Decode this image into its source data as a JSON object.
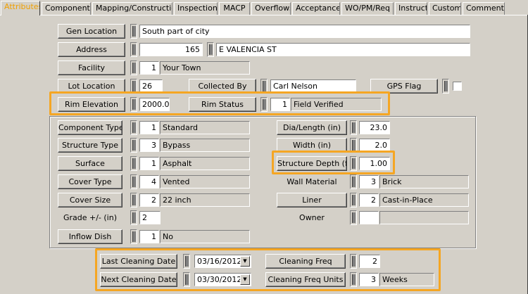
{
  "tabs": [
    "Attributes",
    "Components",
    "Mapping/Construction",
    "Inspections",
    "MACP",
    "Overflows",
    "Acceptance",
    "WO/PM/Req",
    "Instruct",
    "Custom",
    "Comments"
  ],
  "top": {
    "gen_location": {
      "label": "Gen Location",
      "value": "South part of city"
    },
    "address": {
      "label": "Address",
      "number": "165",
      "street": "E VALENCIA ST"
    },
    "facility": {
      "label": "Facility",
      "code": "1",
      "value": "Your Town"
    },
    "lot_location": {
      "label": "Lot Location",
      "value": "26"
    },
    "collected_by": {
      "label": "Collected By",
      "value": "Carl Nelson"
    },
    "gps_flag": {
      "label": "GPS Flag"
    },
    "rim_elevation": {
      "label": "Rim Elevation",
      "value": "2000.00"
    },
    "rim_status": {
      "label": "Rim Status",
      "code": "1",
      "value": "Field Verified"
    }
  },
  "left": {
    "component_type": {
      "label": "Component Type",
      "code": "1",
      "value": "Standard"
    },
    "structure_type": {
      "label": "Structure Type",
      "code": "3",
      "value": "Bypass"
    },
    "surface": {
      "label": "Surface",
      "code": "1",
      "value": "Asphalt"
    },
    "cover_type": {
      "label": "Cover Type",
      "code": "4",
      "value": "Vented"
    },
    "cover_size": {
      "label": "Cover Size",
      "code": "2",
      "value": "22 inch"
    },
    "grade": {
      "label": "Grade +/- (in)",
      "value": "2"
    },
    "inflow_dish": {
      "label": "Inflow Dish",
      "code": "1",
      "value": "No"
    }
  },
  "right": {
    "dia_length": {
      "label": "Dia/Length (in)",
      "value": "23.0"
    },
    "width": {
      "label": "Width (in)",
      "value": "2.0"
    },
    "structure_depth": {
      "label": "Structure Depth (ft)",
      "value": "1.00"
    },
    "wall_material": {
      "label": "Wall Material",
      "code": "3",
      "value": "Brick"
    },
    "liner": {
      "label": "Liner",
      "code": "2",
      "value": "Cast-in-Place"
    },
    "owner": {
      "label": "Owner",
      "code": "",
      "value": ""
    }
  },
  "cleaning": {
    "last_date": {
      "label": "Last Cleaning Date",
      "value": "03/16/2012"
    },
    "next_date": {
      "label": "Next Cleaning Date",
      "value": "03/30/2012"
    },
    "freq": {
      "label": "Cleaning Freq",
      "value": "2"
    },
    "freq_units": {
      "label": "Cleaning Freq Units",
      "code": "3",
      "value": "Weeks"
    }
  },
  "colors": {
    "highlight": "#f5a623",
    "active_tab": "#f0a000",
    "background": "#d4d0c8"
  },
  "icons": {
    "dropdown": "chevron-down-icon"
  }
}
